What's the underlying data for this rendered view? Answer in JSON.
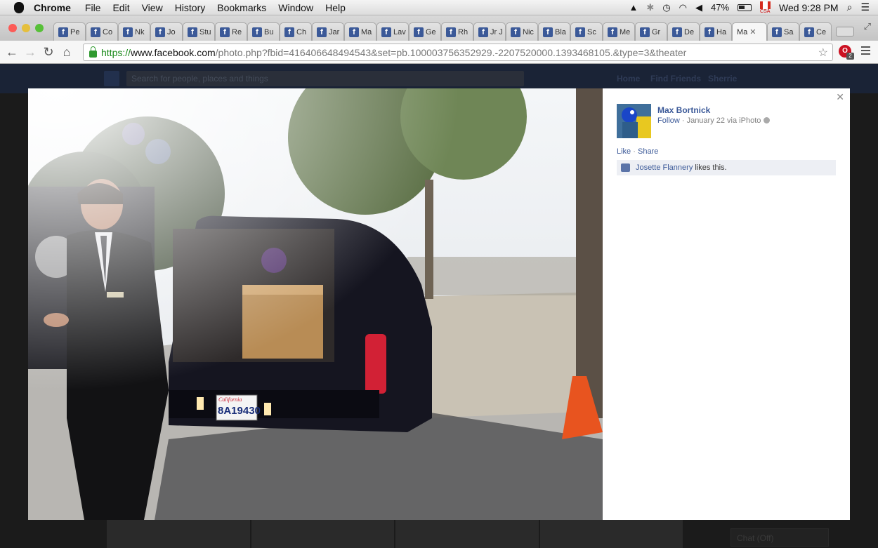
{
  "menubar": {
    "app": "Chrome",
    "items": [
      "File",
      "Edit",
      "View",
      "History",
      "Bookmarks",
      "Window",
      "Help"
    ],
    "battery": "47%",
    "clock": "Wed 9:28 PM",
    "flag_label": "CSA"
  },
  "tabs": [
    {
      "label": "Pe"
    },
    {
      "label": "Co"
    },
    {
      "label": "Nk"
    },
    {
      "label": "Jo"
    },
    {
      "label": "Stu"
    },
    {
      "label": "Re"
    },
    {
      "label": "Bu"
    },
    {
      "label": "Ch"
    },
    {
      "label": "Jar"
    },
    {
      "label": "Ma"
    },
    {
      "label": "Lav"
    },
    {
      "label": "Ge"
    },
    {
      "label": "Rh"
    },
    {
      "label": "Jr J"
    },
    {
      "label": "Nic"
    },
    {
      "label": "Bla"
    },
    {
      "label": "Sc"
    },
    {
      "label": "Me"
    },
    {
      "label": "Gr"
    },
    {
      "label": "De"
    },
    {
      "label": "Ha"
    },
    {
      "label": "Ma",
      "active": true
    },
    {
      "label": "Sa"
    },
    {
      "label": "Ce"
    }
  ],
  "address": {
    "scheme": "https://",
    "host": "www.facebook.com",
    "path": "/photo.php?fbid=416406648494543&set=pb.100003756352929.-2207520000.1393468105.&type=3&theater",
    "extension_badge": "2"
  },
  "fb": {
    "search_placeholder": "Search for people, places and things",
    "nav_home": "Home",
    "nav_find_friends": "Find Friends",
    "nav_user": "Sherrie",
    "chat": "Chat (Off)"
  },
  "photo_panel": {
    "author": "Max Bortnick",
    "follow": "Follow",
    "meta": " · January 22 via iPhoto",
    "like": "Like",
    "share": "Share",
    "liker": "Josette Flannery",
    "likes_suffix": "likes this.",
    "plate": "8A19430",
    "plate_state": "California"
  },
  "colors": {
    "facebook_blue": "#3b5998",
    "url_green": "#1a8a1a"
  }
}
